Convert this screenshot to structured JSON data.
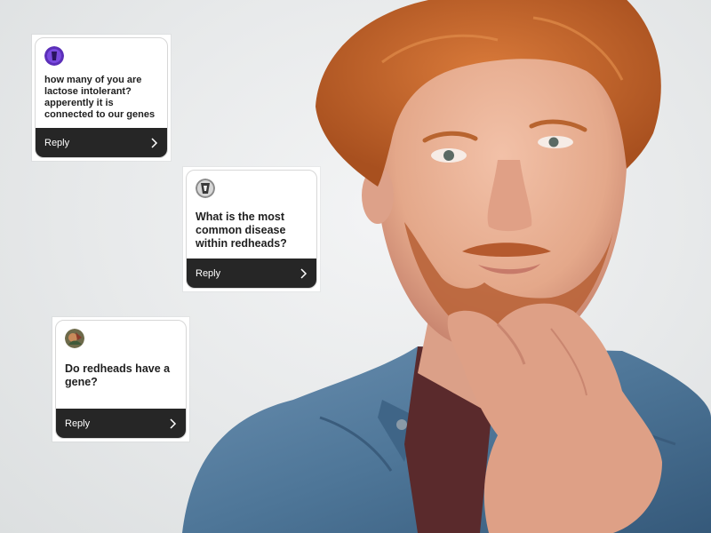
{
  "cards": [
    {
      "question": "how many of you are lactose intolerant? apperently it is connected to our genes",
      "reply_label": "Reply"
    },
    {
      "question": "What is the most common disease within redheads?",
      "reply_label": "Reply"
    },
    {
      "question": "Do redheads have a gene?",
      "reply_label": "Reply"
    }
  ],
  "icons": {
    "avatar": "avatar-icon",
    "chevron": "chevron-right-icon"
  },
  "colors": {
    "reply_bar": "#262626",
    "hair": "#c0622a",
    "jacket": "#4e7698"
  }
}
